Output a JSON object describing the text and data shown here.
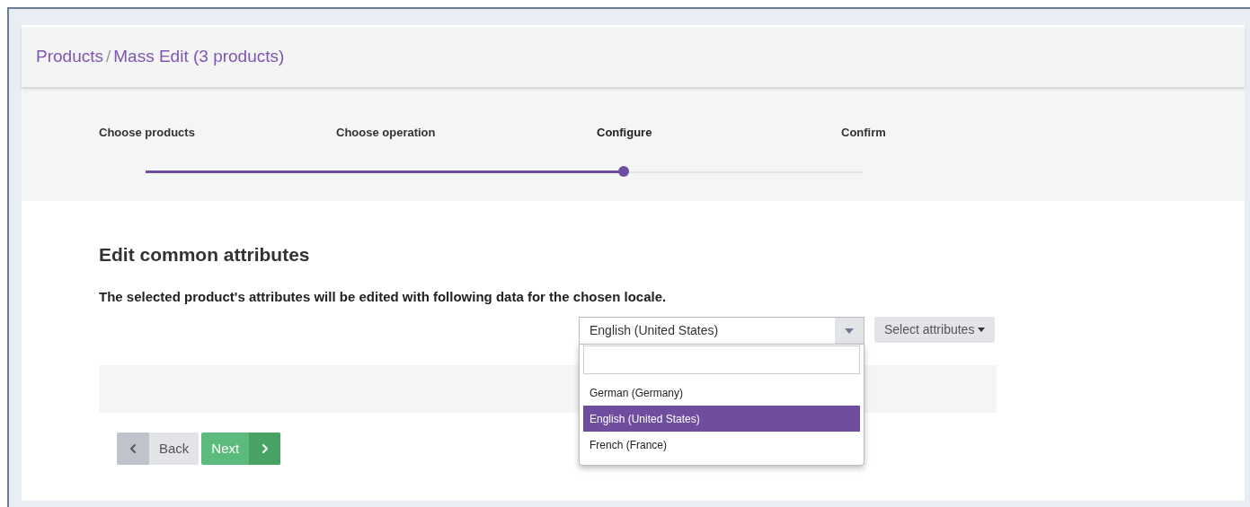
{
  "breadcrumb": [
    {
      "label": "Products"
    },
    {
      "label": "Mass Edit (3 products)"
    }
  ],
  "breadcrumb_separator": "/",
  "stepper": {
    "level": 0.667,
    "steps": [
      {
        "label": "Choose products",
        "selected": false
      },
      {
        "label": "Choose operation",
        "selected": false
      },
      {
        "label": "Configure",
        "selected": true
      },
      {
        "label": "Confirm",
        "selected": false
      }
    ]
  },
  "heading": "Edit common attributes",
  "description": "The selected product's attributes will be edited with following data for the chosen locale.",
  "locale_select": {
    "value": "English (United States)",
    "expanded": true,
    "options": [
      {
        "label": "German (Germany)",
        "selected": false
      },
      {
        "label": "English (United States)",
        "selected": true
      },
      {
        "label": "French (France)",
        "selected": false
      }
    ]
  },
  "attributes_button": "Select attributes",
  "buttons": [
    {
      "kind": "back",
      "label": "Back"
    },
    {
      "kind": "next",
      "label": "Next"
    }
  ]
}
